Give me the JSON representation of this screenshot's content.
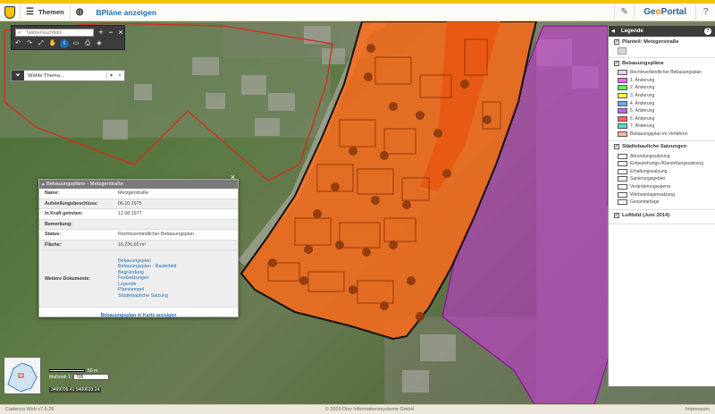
{
  "header": {
    "menu_label": "Themen",
    "title": "BPläne anzeigen",
    "brand_left": "Ge",
    "brand_mid": "o",
    "brand_right": "Portal",
    "icons": [
      "menu-icon",
      "globe-icon",
      "pencil-icon",
      "help-icon"
    ]
  },
  "toolbar": {
    "search_placeholder": "Namensuchfeld",
    "buttons": [
      "zoom-in",
      "zoom-out",
      "close"
    ],
    "tools": [
      "undo",
      "redo",
      "fullscreen",
      "pan",
      "info",
      "measure",
      "print",
      "layers"
    ]
  },
  "theme": {
    "select_placeholder": "Wähle Thema..."
  },
  "popup": {
    "title": "Bebauungspläne - Metzgerstraße",
    "rows": [
      {
        "key": "Name:",
        "value": "Metzgerstraße"
      },
      {
        "key": "Aufstellungsbeschluss:",
        "value": "06.10.1975"
      },
      {
        "key": "In Kraft getreten:",
        "value": "12.08.1977"
      },
      {
        "key": "Bemerkung:",
        "value": ""
      },
      {
        "key": "Status:",
        "value": "Rechtsverbindlicher Bebauungsplan"
      },
      {
        "key": "Fläche:",
        "value": "16.236,60 m²"
      }
    ],
    "docs_key": "Weitere Dokumente:",
    "docs": [
      "Bebauungsplan",
      "Bebauungsplan - Rasterbild",
      "Begründung",
      "Festsetzungen",
      "Legende",
      "Planstempel",
      "Städtebauliche Satzung"
    ],
    "footer_link": "Bebauungsplan in Karte anzeigen"
  },
  "legend": {
    "title": "Legende",
    "help": "?",
    "sections": [
      {
        "title": "Planteil: Metzgerstraße",
        "items": []
      },
      {
        "title": "Bebauungspläne",
        "items": [
          {
            "label": "Rechtsverbindlicher Bebauungsplan",
            "color": "#f0d0f0"
          },
          {
            "label": "1. Änderung",
            "color": "#ff66ff"
          },
          {
            "label": "2. Änderung",
            "color": "#66ee66"
          },
          {
            "label": "3. Änderung",
            "color": "#ffff55"
          },
          {
            "label": "4. Änderung",
            "color": "#66aaff"
          },
          {
            "label": "5. Änderung",
            "color": "#bb66ff"
          },
          {
            "label": "6. Änderung",
            "color": "#ff6666"
          },
          {
            "label": "7. Änderung",
            "color": "#55ddcc"
          },
          {
            "label": "Bebauungsplan im Verfahren",
            "color": "#f4b89a"
          }
        ]
      },
      {
        "title": "Städtebauliche Satzungen",
        "items": [
          {
            "label": "Abrundungssatzung",
            "color": "#ffffff"
          },
          {
            "label": "Einbeziehungs-/Klarstellungssatzung",
            "color": "#ffffff"
          },
          {
            "label": "Erhaltungssatzung",
            "color": "#ffffff"
          },
          {
            "label": "Sanierungsgebiet",
            "color": "#ffffff"
          },
          {
            "label": "Veränderungssperre",
            "color": "#ffffff"
          },
          {
            "label": "Werbeanlagensatzung",
            "color": "#ffffff"
          },
          {
            "label": "Gesamtanlage",
            "color": "#ffffff"
          }
        ]
      },
      {
        "title": "Luftbild (Juni 2014)",
        "items": []
      }
    ]
  },
  "map": {
    "scale_label": "Maßstab 1:",
    "scale_value": "735",
    "scale_bar_label": "50 m",
    "coordinates": "3499706.41 5400633.24"
  },
  "footer": {
    "left": "Cadenza Web v7.6.29",
    "center": "© 2019 Disy Informationssysteme GmbH",
    "right": "Impressum"
  }
}
